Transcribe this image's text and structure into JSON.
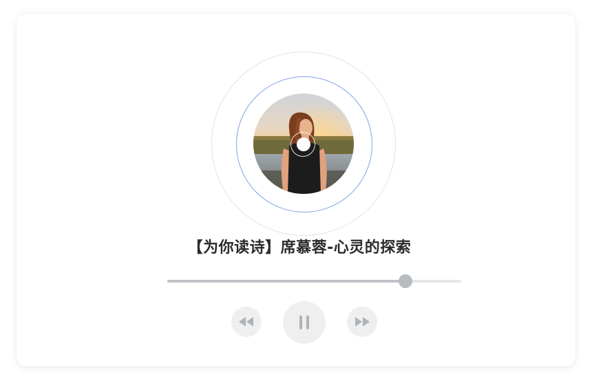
{
  "player": {
    "title": "【为你读诗】席慕蓉-心灵的探索",
    "progress_fraction": 0.81,
    "state": "playing",
    "colors": {
      "accent_ring": "#7ea1e6",
      "progress_fill": "#bfc3c7",
      "progress_track": "#e6e7e9",
      "control_bg": "#efefef",
      "control_icon": "#aeb3b7"
    }
  },
  "controls": {
    "prev_icon": "rewind-icon",
    "play_icon": "pause-icon",
    "next_icon": "fast-forward-icon"
  },
  "cover": {
    "icon": "album-cover-image"
  }
}
